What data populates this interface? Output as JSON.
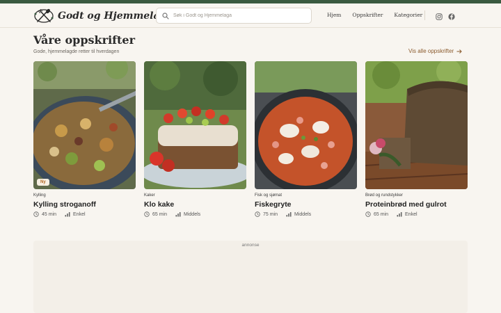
{
  "colors": {
    "accent": "#3a5a40",
    "link": "#8a5a2c",
    "badge_text": "#b2651e",
    "background": "#f8f5f0"
  },
  "brand": {
    "name": "Godt og Hjemmelaga",
    "logo_icon": "utensils-icon"
  },
  "search": {
    "placeholder": "Søk i Godt og Hjemmelaga"
  },
  "nav": {
    "items": [
      {
        "label": "Hjem"
      },
      {
        "label": "Oppskrifter"
      },
      {
        "label": "Kategorier"
      }
    ]
  },
  "social": {
    "icons": [
      "instagram-icon",
      "facebook-icon"
    ]
  },
  "section": {
    "title": "Våre oppskrifter",
    "subtitle": "Gode, hjemmelagde retter til hverdagen",
    "view_all": "Vis alle oppskrifter"
  },
  "recipes": [
    {
      "category": "Kylling",
      "title": "Kylling stroganoff",
      "time": "45 min",
      "difficulty": "Enkel",
      "badge": "Ny"
    },
    {
      "category": "Kaker",
      "title": "Klo kake",
      "time": "65 min",
      "difficulty": "Middels",
      "badge": ""
    },
    {
      "category": "Fisk og sjømat",
      "title": "Fiskegryte",
      "time": "75 min",
      "difficulty": "Middels",
      "badge": ""
    },
    {
      "category": "Brød og rundstykker",
      "title": "Proteinbrød med gulrot",
      "time": "65 min",
      "difficulty": "Enkel",
      "badge": ""
    }
  ],
  "ad": {
    "label": "annonse"
  }
}
